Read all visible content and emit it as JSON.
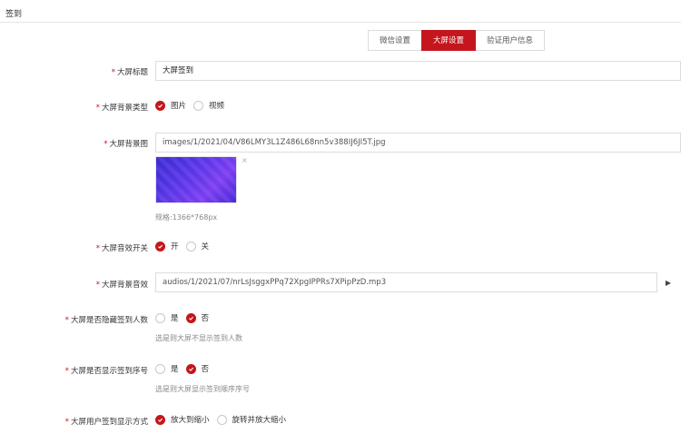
{
  "header": {
    "title": "签到"
  },
  "tabs": [
    {
      "label": "微信设置",
      "active": false
    },
    {
      "label": "大屏设置",
      "active": true
    },
    {
      "label": "验证用户信息",
      "active": false
    }
  ],
  "form": {
    "required_mark": "*",
    "screen_title": {
      "label": "大屏标题",
      "value": "大屏签到"
    },
    "bg_type": {
      "label": "大屏背景类型",
      "options": [
        "图片",
        "视频"
      ],
      "selected": "图片"
    },
    "bg_image": {
      "label": "大屏背景图",
      "value": "images/1/2021/04/V86LMY3L1Z486L68nn5v388IJ6JI5T.jpg",
      "remove": "×",
      "hint": "规格:1366*768px"
    },
    "sound_switch": {
      "label": "大屏音效开关",
      "options": [
        "开",
        "关"
      ],
      "selected": "开"
    },
    "bg_sound": {
      "label": "大屏背景音效",
      "value": "audios/1/2021/07/nrLsJsggxPPq72XpgIPPRs7XPipPzD.mp3",
      "play": "▶"
    },
    "hide_count": {
      "label": "大屏是否隐藏签到人数",
      "options": [
        "是",
        "否"
      ],
      "selected": "否",
      "hint": "选是则大屏不显示签到人数"
    },
    "show_order": {
      "label": "大屏是否显示签到序号",
      "options": [
        "是",
        "否"
      ],
      "selected": "否",
      "hint": "选是则大屏显示签到顺序序号"
    },
    "display_mode": {
      "label": "大屏用户签到显示方式",
      "options": [
        "放大到缩小",
        "旋转并放大缩小"
      ],
      "selected": "放大到缩小"
    }
  },
  "colors": {
    "accent": "#c4161c",
    "border": "#dcdcdc"
  }
}
